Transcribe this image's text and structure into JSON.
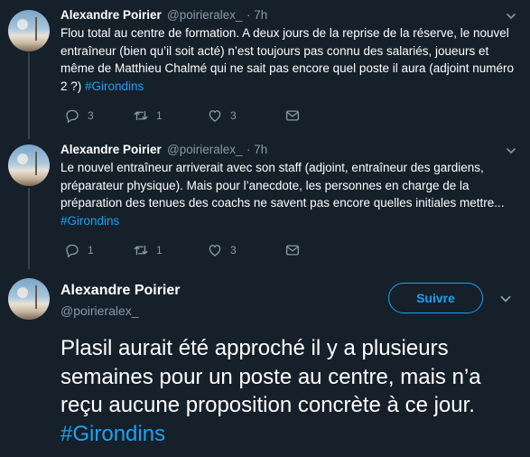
{
  "tweets": [
    {
      "name": "Alexandre Poirier",
      "handle": "@poirieralex_",
      "time": "· 7h",
      "text": "Flou total au centre de formation. A deux jours de la reprise de la réserve, le nouvel entraîneur (bien qu’il soit acté) n’est toujours pas connu des salariés, joueurs et même de Matthieu Chalmé qui ne sait pas encore quel poste il aura (adjoint numéro 2 ?) ",
      "hashtag": "#Girondins",
      "replies": "3",
      "retweets": "1",
      "likes": "3"
    },
    {
      "name": "Alexandre Poirier",
      "handle": "@poirieralex_",
      "time": "· 7h",
      "text": "Le nouvel entraîneur arriverait avec son staff (adjoint, entraîneur des gardiens, préparateur physique). Mais pour l’anecdote, les personnes en charge de la préparation des tenues des coachs ne savent pas encore quelles initiales mettre...",
      "hashtag": "#Girondins",
      "replies": "1",
      "retweets": "1",
      "likes": "3"
    }
  ],
  "main_tweet": {
    "name": "Alexandre Poirier",
    "handle": "@poirieralex_",
    "follow_label": "Suivre",
    "text": "Plasil aurait été approché il y a plusieurs semaines pour un poste au centre, mais n’a reçu aucune proposition concrète à ce jour. ",
    "hashtag": "#Girondins"
  },
  "colors": {
    "background": "#15202b",
    "accent": "#1da1f2",
    "secondary_text": "#8899a6",
    "divider": "#38444d"
  },
  "icons": [
    "reply-icon",
    "retweet-icon",
    "like-icon",
    "message-icon",
    "chevron-down-icon"
  ]
}
